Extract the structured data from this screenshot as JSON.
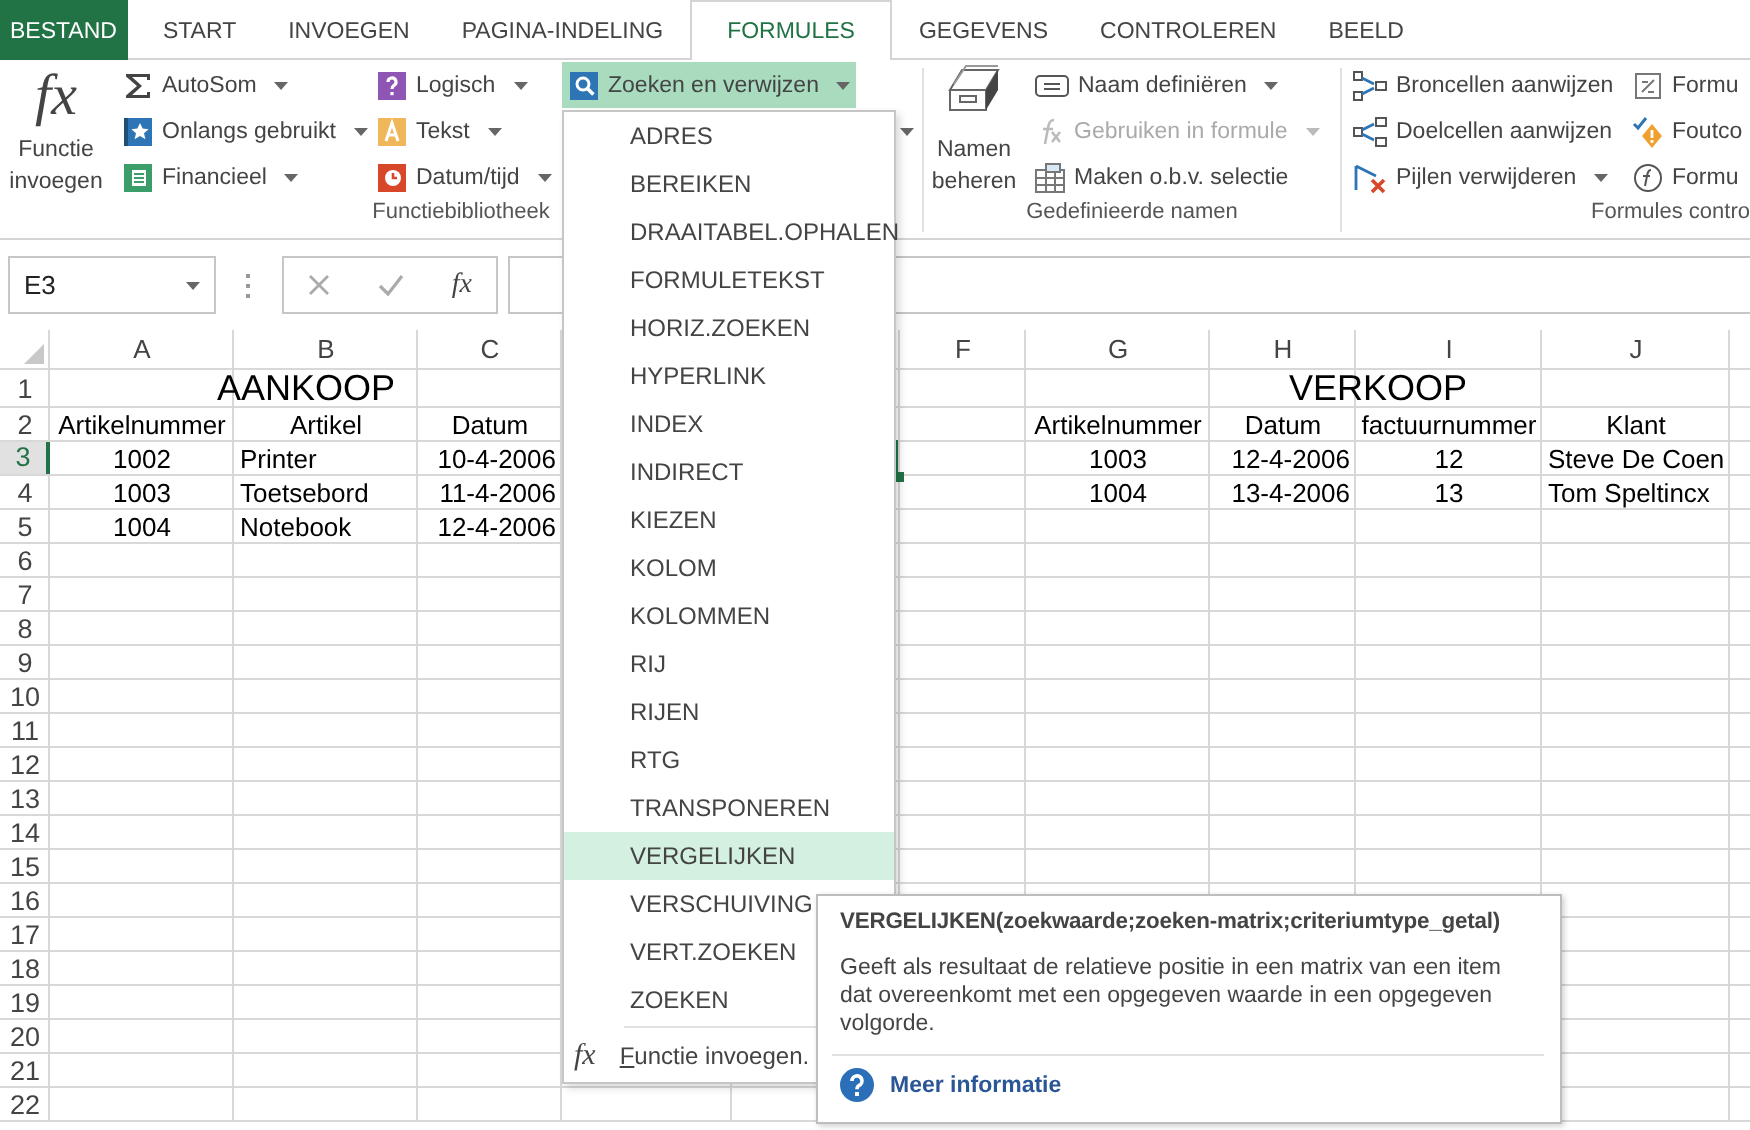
{
  "tabs": [
    {
      "label": "BESTAND",
      "kind": "file",
      "selected": false
    },
    {
      "label": "START",
      "kind": "tab",
      "selected": false
    },
    {
      "label": "INVOEGEN",
      "kind": "tab",
      "selected": false
    },
    {
      "label": "PAGINA-INDELING",
      "kind": "tab",
      "selected": false
    },
    {
      "label": "FORMULES",
      "kind": "tab",
      "selected": true
    },
    {
      "label": "GEGEVENS",
      "kind": "tab",
      "selected": false
    },
    {
      "label": "CONTROLEREN",
      "kind": "tab",
      "selected": false
    },
    {
      "label": "BEELD",
      "kind": "tab",
      "selected": false
    }
  ],
  "ribbon": {
    "groups": [
      {
        "label": "Functiebibliotheek",
        "large": {
          "symbol": "fx",
          "label": "Functie invoegen"
        },
        "columns": [
          [
            {
              "label": "AutoSom",
              "dropdown": true,
              "disabled": false,
              "expanded": false
            },
            {
              "label": "Onlangs gebruikt",
              "dropdown": true,
              "disabled": false,
              "expanded": false
            },
            {
              "label": "Financieel",
              "dropdown": true,
              "disabled": false,
              "expanded": false
            }
          ],
          [
            {
              "label": "Logisch",
              "dropdown": true,
              "disabled": false,
              "expanded": false
            },
            {
              "label": "Tekst",
              "dropdown": true,
              "disabled": false,
              "expanded": false
            },
            {
              "label": "Datum/tijd",
              "dropdown": true,
              "disabled": false,
              "expanded": false
            }
          ],
          [
            {
              "label": "Zoeken en verwijzen",
              "dropdown": true,
              "disabled": false,
              "expanded": true
            },
            {
              "dropdown": true,
              "disabled": false,
              "expanded": false
            }
          ]
        ]
      },
      {
        "label": "Gedefinieerde namen",
        "large": {
          "label": "Namen beheren"
        },
        "columns": [
          [
            {
              "label": "Naam definiëren",
              "dropdown": true,
              "disabled": false,
              "expanded": false
            },
            {
              "label": "Gebruiken in formule",
              "dropdown": true,
              "disabled": true,
              "expanded": false
            },
            {
              "label": "Maken o.b.v. selectie",
              "dropdown": false,
              "disabled": false,
              "expanded": false
            }
          ]
        ]
      },
      {
        "label": "Formules contro",
        "columns": [
          [
            {
              "label": "Broncellen aanwijzen",
              "dropdown": false,
              "disabled": false,
              "expanded": false
            },
            {
              "label": "Doelcellen aanwijzen",
              "dropdown": false,
              "disabled": false,
              "expanded": false
            },
            {
              "label": "Pijlen verwijderen",
              "dropdown": true,
              "disabled": false,
              "expanded": false
            }
          ],
          [
            {
              "label": "Formu",
              "dropdown": false,
              "disabled": false,
              "expanded": false
            },
            {
              "label": "Foutco",
              "dropdown": false,
              "disabled": false,
              "expanded": false
            },
            {
              "label": "Formu",
              "dropdown": false,
              "disabled": false,
              "expanded": false
            }
          ]
        ]
      }
    ]
  },
  "formula_bar": {
    "name_box": "E3",
    "function_symbol": "fx"
  },
  "sheet": {
    "columns": [
      "A",
      "B",
      "C",
      "F",
      "G",
      "H",
      "I",
      "J"
    ],
    "row_headers": [
      {
        "label": "1",
        "selected": false
      },
      {
        "label": "2",
        "selected": false
      },
      {
        "label": "3",
        "selected": true
      },
      {
        "label": "4",
        "selected": false
      },
      {
        "label": "5",
        "selected": false
      },
      {
        "label": "6",
        "selected": false
      },
      {
        "label": "7",
        "selected": false
      },
      {
        "label": "8",
        "selected": false
      },
      {
        "label": "9",
        "selected": false
      },
      {
        "label": "10",
        "selected": false
      },
      {
        "label": "11",
        "selected": false
      },
      {
        "label": "12",
        "selected": false
      },
      {
        "label": "13",
        "selected": false
      },
      {
        "label": "14",
        "selected": false
      },
      {
        "label": "15",
        "selected": false
      },
      {
        "label": "16",
        "selected": false
      },
      {
        "label": "17",
        "selected": false
      },
      {
        "label": "18",
        "selected": false
      },
      {
        "label": "19",
        "selected": false
      },
      {
        "label": "20",
        "selected": false
      },
      {
        "label": "21",
        "selected": false
      },
      {
        "label": "22",
        "selected": false
      }
    ],
    "purchases": {
      "title": "AANKOOP",
      "header": [
        "Artikelnummer",
        "Artikel",
        "Datum"
      ],
      "rows": [
        [
          "1002",
          "Printer",
          "10-4-2006"
        ],
        [
          "1003",
          "Toetsebord",
          "11-4-2006"
        ],
        [
          "1004",
          "Notebook",
          "12-4-2006"
        ]
      ]
    },
    "sales": {
      "title": "VERKOOP",
      "header": [
        "Artikelnummer",
        "Datum",
        "factuurnummer",
        "Klant"
      ],
      "rows": [
        [
          "1003",
          "12-4-2006",
          "12",
          "Steve De Coen"
        ],
        [
          "1004",
          "13-4-2006",
          "13",
          "Tom Speltincx"
        ]
      ]
    }
  },
  "menu": {
    "items": [
      {
        "label": "ADRES",
        "selected": false
      },
      {
        "label": "BEREIKEN",
        "selected": false
      },
      {
        "label": "DRAAITABEL.OPHALEN",
        "selected": false
      },
      {
        "label": "FORMULETEKST",
        "selected": false
      },
      {
        "label": "HORIZ.ZOEKEN",
        "selected": false
      },
      {
        "label": "HYPERLINK",
        "selected": false
      },
      {
        "label": "INDEX",
        "selected": false
      },
      {
        "label": "INDIRECT",
        "selected": false
      },
      {
        "label": "KIEZEN",
        "selected": false
      },
      {
        "label": "KOLOM",
        "selected": false
      },
      {
        "label": "KOLOMMEN",
        "selected": false
      },
      {
        "label": "RIJ",
        "selected": false
      },
      {
        "label": "RIJEN",
        "selected": false
      },
      {
        "label": "RTG",
        "selected": false
      },
      {
        "label": "TRANSPONEREN",
        "selected": false
      },
      {
        "label": "VERGELIJKEN",
        "selected": true
      },
      {
        "label": "VERSCHUIVING",
        "selected": false
      },
      {
        "label": "VERT.ZOEKEN",
        "selected": false
      },
      {
        "label": "ZOEKEN",
        "selected": false
      }
    ],
    "footer": {
      "symbol": "fx",
      "label": "Functie invoegen."
    }
  },
  "tooltip": {
    "title": "VERGELIJKEN(zoekwaarde;zoeken-matrix;criteriumtype_getal)",
    "description": "Geeft als resultaat de relatieve positie in een matrix van een item dat overeenkomt met een opgegeven waarde in een opgegeven volgorde.",
    "link": "Meer informatie"
  }
}
